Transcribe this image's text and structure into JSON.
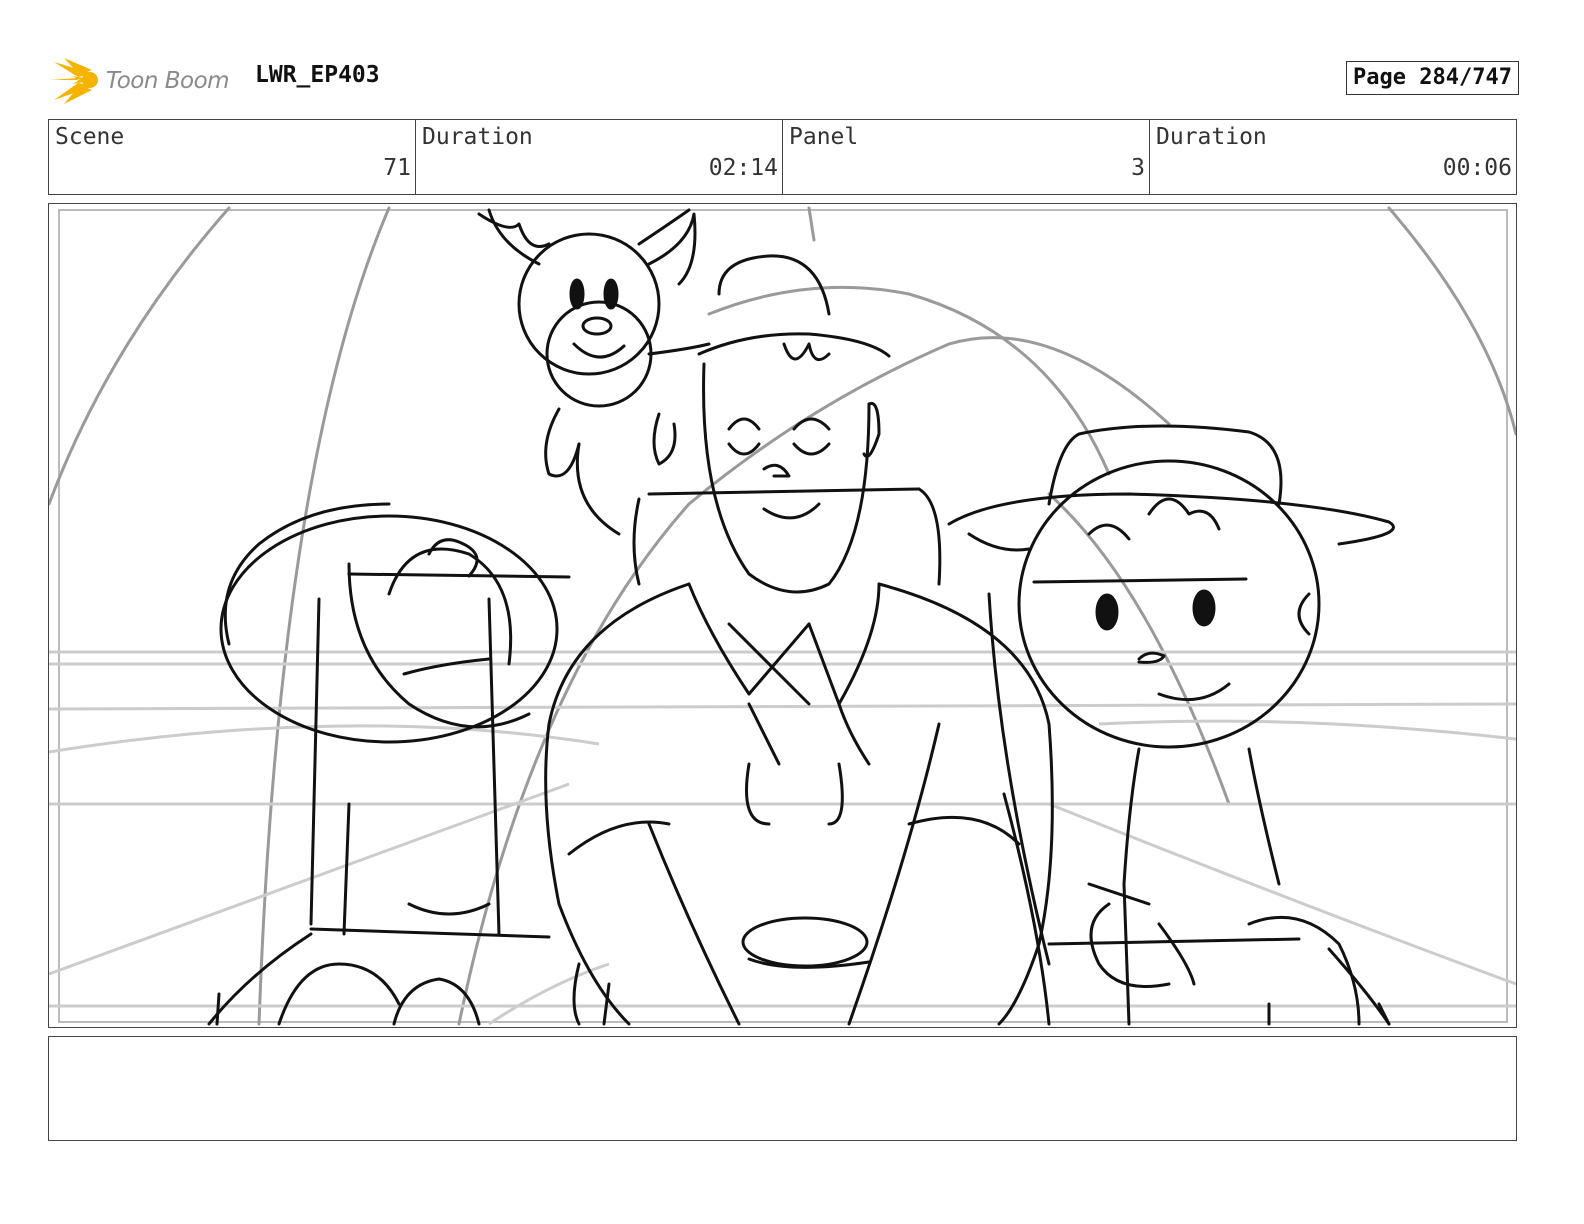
{
  "header": {
    "logo_text": "Toon Boom",
    "project_title": "LWR_EP403",
    "page_label": "Page 284/747"
  },
  "info": {
    "scene_label": "Scene",
    "scene_value": "71",
    "scene_duration_label": "Duration",
    "scene_duration_value": "02:14",
    "panel_label": "Panel",
    "panel_value": "3",
    "panel_duration_label": "Duration",
    "panel_duration_value": "00:06"
  },
  "notes": {
    "text": ""
  },
  "colors": {
    "logo_yellow": "#f5b400",
    "logo_text": "#8a8a8a",
    "border": "#444444"
  },
  "icons": {
    "logo": "toon-boom-sunburst-icon"
  }
}
